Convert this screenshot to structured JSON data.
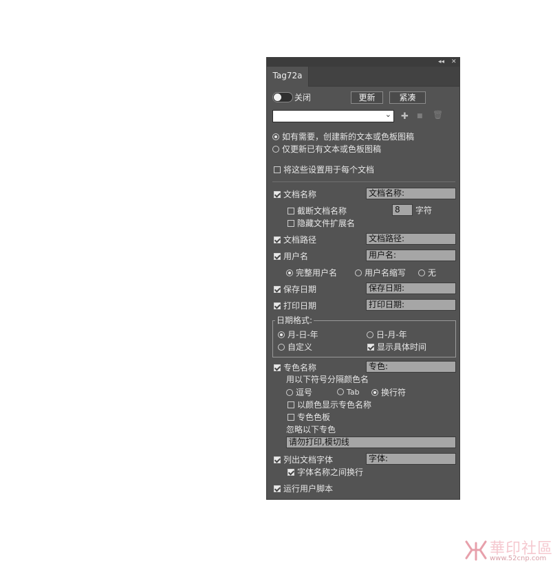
{
  "window": {
    "collapse_glyph": "◂◂",
    "close_glyph": "✕"
  },
  "tab": {
    "label": "Tag72a"
  },
  "header": {
    "toggle_label": "关闭",
    "toggle_on": false,
    "update_button": "更新",
    "compact_button": "紧凑"
  },
  "preset": {
    "value": "",
    "chevron": "⌄"
  },
  "preset_icons": {
    "add": "✚",
    "save": "■",
    "delete": "🗑"
  },
  "mode_options": [
    {
      "label": "如有需要，创建新的文本或色板图稿",
      "selected": true
    },
    {
      "label": "仅更新已有文本或色板图稿",
      "selected": false
    }
  ],
  "apply_all": {
    "label": "将这些设置用于每个文档",
    "checked": false
  },
  "doc_name": {
    "label": "文档名称",
    "checked": true,
    "field": "文档名称:"
  },
  "truncate": {
    "label": "截断文档名称",
    "checked": false,
    "count": "8",
    "unit": "字符"
  },
  "hide_ext": {
    "label": "隐藏文件扩展名",
    "checked": false
  },
  "doc_path": {
    "label": "文档路径",
    "checked": true,
    "field": "文档路径:"
  },
  "user_name": {
    "label": "用户名",
    "checked": true,
    "field": "用户名:"
  },
  "user_name_opts": [
    {
      "label": "完整用户名",
      "selected": true
    },
    {
      "label": "用户名缩写",
      "selected": false
    },
    {
      "label": "无",
      "selected": false
    }
  ],
  "save_date": {
    "label": "保存日期",
    "checked": true,
    "field": "保存日期:"
  },
  "print_date": {
    "label": "打印日期",
    "checked": true,
    "field": "打印日期:"
  },
  "date_format": {
    "group_label": "日期格式:",
    "mdy": {
      "label": "月-日-年",
      "selected": true
    },
    "dmy": {
      "label": "日-月-年",
      "selected": false
    },
    "custom": {
      "label": "自定义",
      "selected": false
    },
    "show_time": {
      "label": "显示具体时间",
      "checked": true
    }
  },
  "spot": {
    "label": "专色名称",
    "checked": true,
    "field": "专色:",
    "sep_label": "用以下符号分隔颜色名",
    "sep_opts": [
      {
        "label": "逗号",
        "selected": false
      },
      {
        "label": "Tab",
        "selected": false
      },
      {
        "label": "换行符",
        "selected": true
      }
    ],
    "show_color": {
      "label": "以颜色显示专色名称",
      "checked": false
    },
    "swatch": {
      "label": "专色色板",
      "checked": false
    },
    "ignore_label": "忽略以下专色",
    "ignore_field": "请勿打印,模切线"
  },
  "fonts": {
    "label": "列出文档字体",
    "checked": true,
    "field": "字体:",
    "newline": {
      "label": "字体名称之间换行",
      "checked": true
    }
  },
  "user_script": {
    "label": "运行用户脚本",
    "checked": true
  },
  "watermark": {
    "text": "華印社區",
    "url": "www.52cnp.com"
  }
}
